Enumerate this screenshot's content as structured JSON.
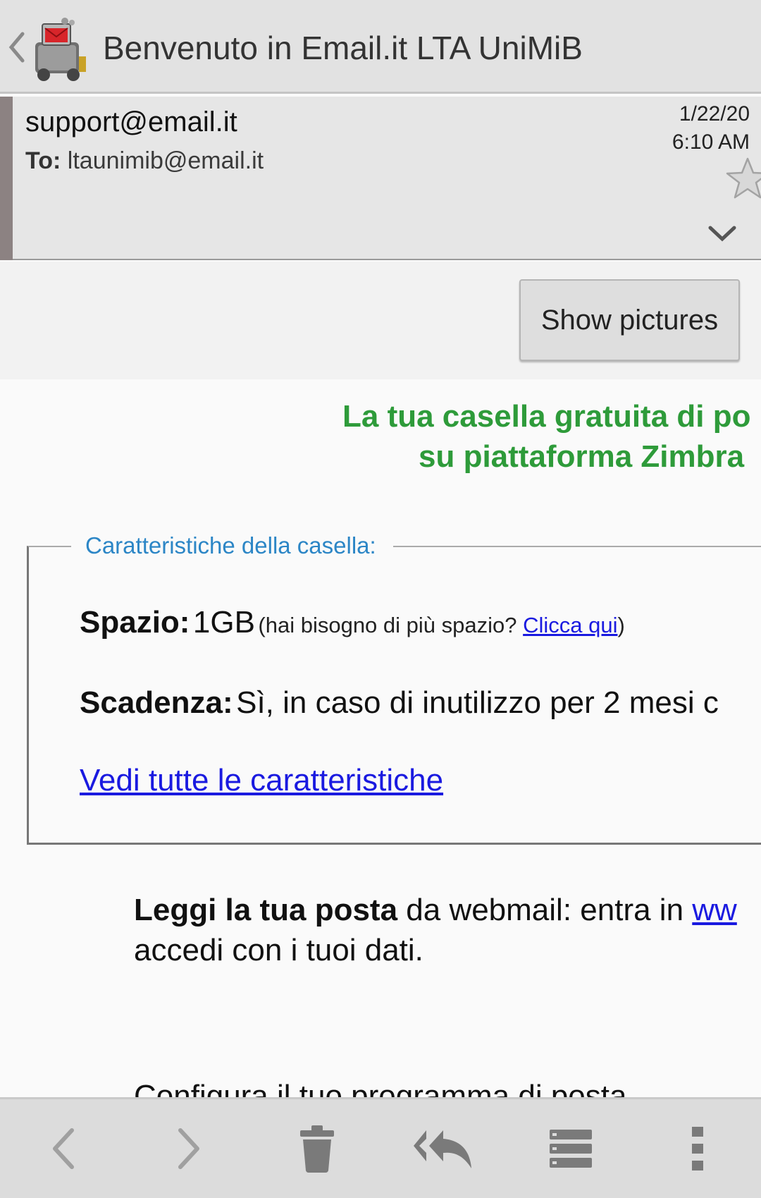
{
  "header": {
    "title": "Benvenuto in Email.it LTA UniMiB",
    "back_icon": "chevron-left-icon",
    "logo_icon": "mail-robot-logo-icon"
  },
  "message": {
    "from": "support@email.it",
    "to_label": "To:",
    "to": "ltaunimib@email.it",
    "date": "1/22/20",
    "time": "6:10 AM",
    "star_icon": "star-icon",
    "expand_icon": "chevron-down-icon"
  },
  "pictures": {
    "show_label": "Show pictures"
  },
  "body": {
    "headline_line1": "La tua casella gratuita di po",
    "headline_line2": "su piattaforma Zimbra",
    "features_legend": "Caratteristiche della casella:",
    "spazio_label": "Spazio:",
    "spazio_value": "1GB",
    "spazio_note_open": "(hai bisogno di più spazio?",
    "spazio_link": "Clicca qui",
    "spazio_note_close": ")",
    "scadenza_label": "Scadenza:",
    "scadenza_value": "Sì, in caso di inutilizzo per 2 mesi c",
    "features_link": "Vedi tutte le caratteristiche",
    "read_bold": "Leggi la tua posta",
    "read_text": " da webmail: entra in ",
    "read_link": "ww",
    "read_line2": "accedi con i tuoi dati.",
    "cut_text": "Configura il tuo programma di posta"
  },
  "toolbar": {
    "items": [
      "chevron-left-icon",
      "chevron-right-icon",
      "trash-icon",
      "reply-all-icon",
      "list-icon",
      "overflow-menu-icon"
    ]
  },
  "colors": {
    "headline": "#2e9b3a",
    "legend": "#2c86c6",
    "link": "#1a1ae0",
    "toolbar_bg": "#dcdcdc",
    "icon_gray": "#8a8a8a"
  }
}
